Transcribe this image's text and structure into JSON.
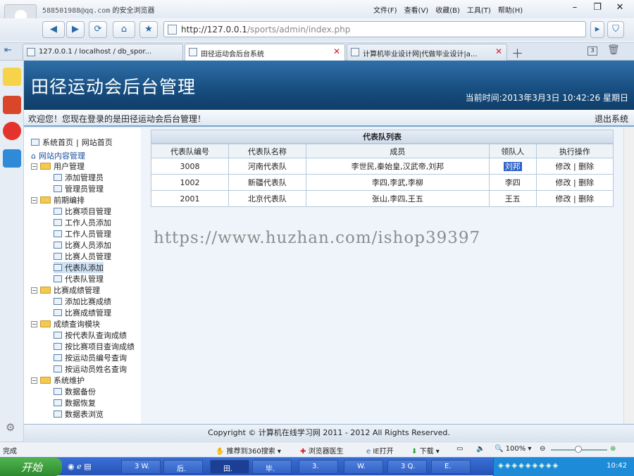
{
  "browser": {
    "account": "588501988@qq.com",
    "account_suffix": "的安全浏览器",
    "menu": [
      "文件(F)",
      "查看(V)",
      "收藏(B)",
      "工具(T)",
      "帮助(H)"
    ],
    "address_host": "http://127.0.0.1",
    "address_path": "/sports/admin/index.php",
    "tabs": [
      {
        "label": "127.0.0.1 / localhost / db_spor..."
      },
      {
        "label": "田径运动会后台系统"
      },
      {
        "label": "计算机毕业设计网|代做毕业设计|a..."
      }
    ],
    "tab_count": "3"
  },
  "page": {
    "title": "田径运动会后台管理",
    "time_label": "当前时间:",
    "time_value": "2013年3月3日  10:42:26 星期日",
    "welcome": "欢迎您！您现在登录的是田径运动会后台管理！",
    "logout": "退出系统"
  },
  "tree": {
    "top_links": [
      "系统首页",
      "网站首页"
    ],
    "root": "网站内容管理",
    "groups": [
      {
        "label": "用户管理",
        "items": [
          "添加管理员",
          "管理员管理"
        ]
      },
      {
        "label": "前期编排",
        "items": [
          "比赛项目管理",
          "工作人员添加",
          "工作人员管理",
          "比赛人员添加",
          "比赛人员管理",
          "代表队添加",
          "代表队管理"
        ]
      },
      {
        "label": "比赛成绩管理",
        "items": [
          "添加比赛成绩",
          "比赛成绩管理"
        ]
      },
      {
        "label": "成绩查询模块",
        "items": [
          "按代表队查询成绩",
          "按比赛项目查询成绩",
          "按运动员编号查询",
          "按运动员姓名查询"
        ]
      },
      {
        "label": "系统维护",
        "items": [
          "数据备份",
          "数据恢复",
          "数据表浏览"
        ]
      }
    ]
  },
  "table": {
    "caption": "代表队列表",
    "headers": [
      "代表队编号",
      "代表队名称",
      "成员",
      "领队人",
      "执行操作"
    ],
    "rows": [
      {
        "id": "3008",
        "name": "河南代表队",
        "members": "李世民,秦始皇,汉武帝,刘邦",
        "leader": "刘邦",
        "edit": "修改",
        "del": "删除"
      },
      {
        "id": "1002",
        "name": "新疆代表队",
        "members": "李四,李武,李柳",
        "leader": "李四",
        "edit": "修改",
        "del": "删除"
      },
      {
        "id": "2001",
        "name": "北京代表队",
        "members": "张山,李四,王五",
        "leader": "王五",
        "edit": "修改",
        "del": "删除"
      }
    ]
  },
  "watermark": "https://www.huzhan.com/ishop39397",
  "footer": "Copyright © 计算机在线学习网  2011 - 2012 All Rights Reserved.",
  "statusbar": {
    "left": "完成",
    "items": [
      "推荐到360搜索",
      "浏览器医生",
      "IE打开",
      "下载"
    ],
    "zoom": "100%"
  },
  "taskbar": {
    "start": "开始",
    "items": [
      "3 W.",
      "后.",
      "田.",
      "毕.",
      "3.",
      "W.",
      "3 Q.",
      "E."
    ],
    "clock": "10:42"
  },
  "colors": {
    "banner": "#174d7f",
    "highlight": "#2f62c7",
    "accent": "#2b6aa8"
  }
}
